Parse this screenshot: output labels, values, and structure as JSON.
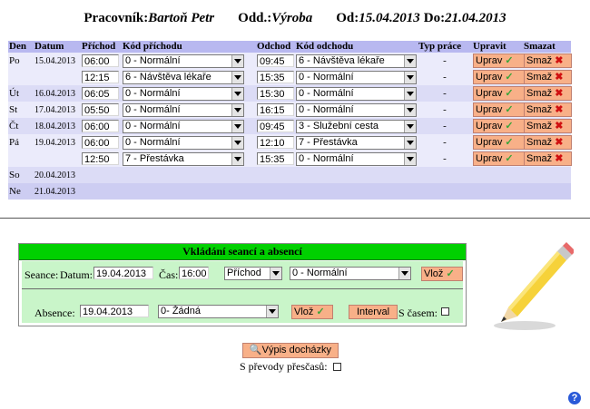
{
  "header": {
    "employee_label": "Pracovník:",
    "employee_name": "Bartoň Petr",
    "dept_label": "Odd.:",
    "dept_name": "Výroba",
    "from_label": "Od:",
    "from_date": "15.04.2013",
    "to_label": "Do:",
    "to_date": "21.04.2013"
  },
  "table": {
    "columns": [
      "Den",
      "Datum",
      "Příchod",
      "Kód příchodu",
      "Odchod",
      "Kód odchodu",
      "Typ práce",
      "Upravit",
      "Smazat"
    ],
    "edit_label": "Uprav",
    "delete_label": "Smaž",
    "rows": [
      {
        "day": "Po",
        "date": "15.04.2013",
        "arrival": "06:00",
        "arrival_code": "0 - Normální",
        "departure": "09:45",
        "departure_code": "6 - Návštěva lékaře",
        "work_type": "-",
        "shade": "r1"
      },
      {
        "day": "",
        "date": "",
        "arrival": "12:15",
        "arrival_code": "6 - Návštěva lékaře",
        "departure": "15:35",
        "departure_code": "0 - Normální",
        "work_type": "-",
        "shade": "r1"
      },
      {
        "day": "Út",
        "date": "16.04.2013",
        "arrival": "06:05",
        "arrival_code": "0 - Normální",
        "departure": "15:30",
        "departure_code": "0 - Normální",
        "work_type": "-",
        "shade": "r2"
      },
      {
        "day": "St",
        "date": "17.04.2013",
        "arrival": "05:50",
        "arrival_code": "0 - Normální",
        "departure": "16:15",
        "departure_code": "0 - Normální",
        "work_type": "-",
        "shade": "r1"
      },
      {
        "day": "Čt",
        "date": "18.04.2013",
        "arrival": "06:00",
        "arrival_code": "0 - Normální",
        "departure": "09:45",
        "departure_code": "3 - Služební cesta",
        "work_type": "-",
        "shade": "r2"
      },
      {
        "day": "Pá",
        "date": "19.04.2013",
        "arrival": "06:00",
        "arrival_code": "0 - Normální",
        "departure": "12:10",
        "departure_code": "7 - Přestávka",
        "work_type": "-",
        "shade": "r1"
      },
      {
        "day": "",
        "date": "",
        "arrival": "12:50",
        "arrival_code": "7 - Přestávka",
        "departure": "15:35",
        "departure_code": "0 - Normální",
        "work_type": "-",
        "shade": "r1"
      }
    ],
    "empty_rows": [
      {
        "day": "So",
        "date": "20.04.2013"
      },
      {
        "day": "Ne",
        "date": "21.04.2013"
      }
    ]
  },
  "panel": {
    "title": "Vkládání seancí a absencí",
    "seance_label": "Seance:",
    "date_label": "Datum:",
    "date_value": "19.04.2013",
    "time_label": "Čas:",
    "time_value": "16:00",
    "direction_value": "Příchod",
    "code_value": "0 - Normální",
    "insert_label": "Vlož",
    "absence_label": "Absence:",
    "absence_date": "19.04.2013",
    "absence_value": "0- Žádná",
    "interval_label": "Interval",
    "with_time_label": "S časem:"
  },
  "footer": {
    "report_label": "Výpis docházky",
    "overtime_label": "S převody přesčasů:",
    "help_symbol": "?"
  },
  "icons": {
    "checkmark": "check-icon",
    "delete": "x-icon",
    "search": "magnifier-icon",
    "help": "help-icon",
    "pencil": "pencil-icon"
  },
  "colors": {
    "header_row": "#b8b8f0",
    "row_light": "#ebebfb",
    "button": "#f8b088",
    "panel_title": "#00d000",
    "panel_body": "#c9f5c9"
  }
}
